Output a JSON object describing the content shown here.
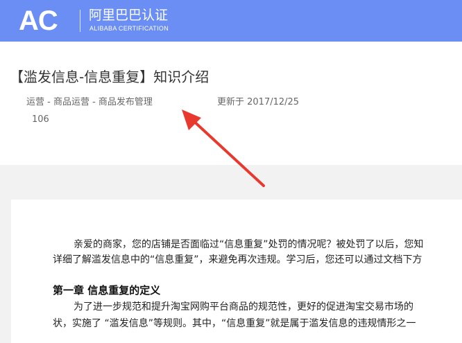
{
  "header": {
    "logo_text": "AC",
    "brand_cn": "阿里巴巴认证",
    "brand_en": "ALIBABA CERTIFICATION",
    "bg_color": "#6a8ef3"
  },
  "page": {
    "title": "【滥发信息-信息重复】知识介绍",
    "breadcrumb": "运营 - 商品运营 - 商品发布管理",
    "updated": "更新于 2017/12/25",
    "views": "106"
  },
  "article": {
    "intro_line1": "亲爱的商家，您的店铺是否面临过“信息重复”处罚的情况呢？被处罚了以后，您知",
    "intro_line2": "详细了解滥发信息中的“信息重复”，来避免再次违规。学习后，您还可以通过文档下方",
    "chapter1_heading": "第一章 信息重复的定义",
    "chapter1_line1": "为了进一步规范和提升淘宝网购平台商品的规范性，更好的促进淘宝交易市场的",
    "chapter1_line2": "状，实施了 “滥发信息”等规则。其中，“信息重复”就是属于滥发信息的违规情形之一"
  },
  "annotation": {
    "arrow_color": "#e8392f"
  }
}
